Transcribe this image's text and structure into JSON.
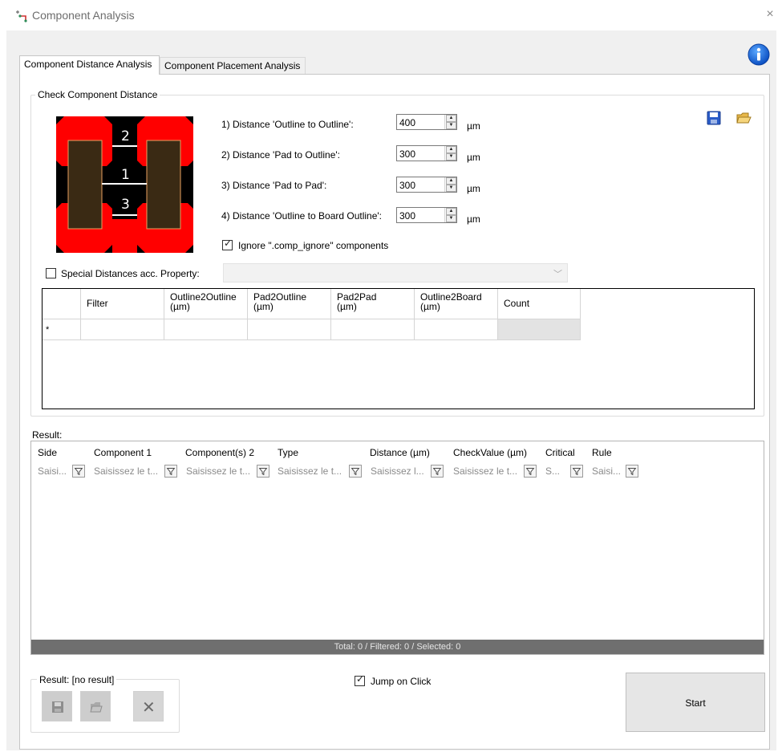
{
  "window": {
    "title": "Component Analysis",
    "close_glyph": "×"
  },
  "tabs": [
    {
      "label": "Component Distance Analysis",
      "active": true
    },
    {
      "label": "Component Placement Analysis",
      "active": false
    }
  ],
  "check_group": {
    "title": "Check Component Distance",
    "diagram_labels": [
      "2",
      "1",
      "3"
    ],
    "distances": [
      {
        "label": "1) Distance 'Outline to Outline':",
        "value": "400",
        "unit": "µm"
      },
      {
        "label": "2) Distance 'Pad to Outline':",
        "value": "300",
        "unit": "µm"
      },
      {
        "label": "3) Distance 'Pad to Pad':",
        "value": "300",
        "unit": "µm"
      },
      {
        "label": "4) Distance 'Outline to Board Outline':",
        "value": "300",
        "unit": "µm"
      }
    ],
    "ignore_checkbox": {
      "label": "Ignore \".comp_ignore\" components",
      "checked": true
    },
    "special_checkbox": {
      "label": "Special Distances acc. Property:",
      "checked": false
    },
    "special_combo_value": "",
    "grid": {
      "columns": [
        {
          "l1": "",
          "l2": ""
        },
        {
          "l1": "Filter",
          "l2": ""
        },
        {
          "l1": "Outline2Outline",
          "l2": "(µm)"
        },
        {
          "l1": "Pad2Outline",
          "l2": "(µm)"
        },
        {
          "l1": "Pad2Pad",
          "l2": "(µm)"
        },
        {
          "l1": "Outline2Board",
          "l2": "(µm)"
        },
        {
          "l1": "Count",
          "l2": ""
        }
      ],
      "new_row_marker": "*"
    }
  },
  "result": {
    "label": "Result:",
    "columns": [
      {
        "header": "Side",
        "filter": "Saisi..."
      },
      {
        "header": "Component 1",
        "filter": "Saisissez le t..."
      },
      {
        "header": "Component(s) 2",
        "filter": "Saisissez le t..."
      },
      {
        "header": "Type",
        "filter": "Saisissez le t..."
      },
      {
        "header": "Distance (µm)",
        "filter": "Saisissez l..."
      },
      {
        "header": "CheckValue (µm)",
        "filter": "Saisissez le t..."
      },
      {
        "header": "Critical",
        "filter": "S..."
      },
      {
        "header": "Rule",
        "filter": "Saisi..."
      }
    ],
    "status": "Total: 0 / Filtered: 0 / Selected: 0"
  },
  "bottom": {
    "result_group_title": "Result: [no result]",
    "jump_checkbox": {
      "label": "Jump on Click",
      "checked": true
    },
    "start_label": "Start"
  },
  "icons": {
    "app": "app-icon",
    "info": "info-icon",
    "save": "save-icon",
    "open": "open-folder-icon",
    "delete": "close-x-icon",
    "filter": "filter-funnel-icon"
  }
}
